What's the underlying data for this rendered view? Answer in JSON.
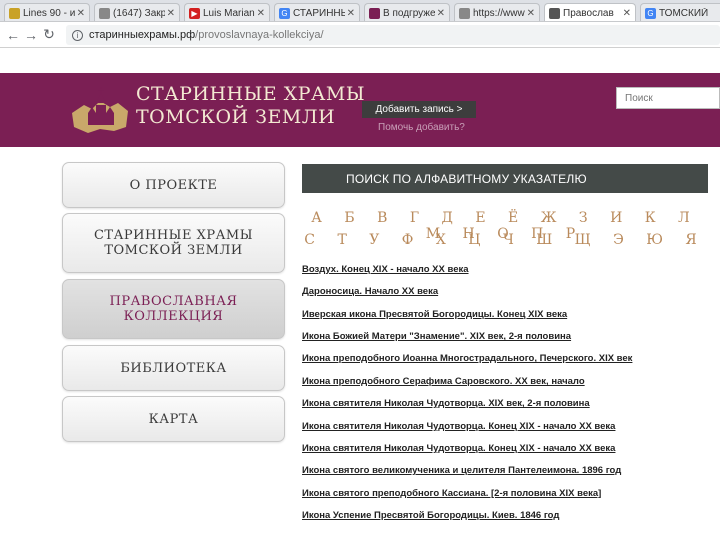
{
  "browser": {
    "tabs": [
      {
        "label": "Lines 90 - и",
        "color": "#c9a227"
      },
      {
        "label": "(1647) Закр",
        "color": "#888888"
      },
      {
        "label": "Luis Mariano",
        "color": "#d32020"
      },
      {
        "label": "СТАРИННЫ",
        "color": "#4285f4"
      },
      {
        "label": "В подгруже",
        "color": "#7b1f54"
      },
      {
        "label": "https://www.",
        "color": "#888888"
      },
      {
        "label": "Православ",
        "color": "#555555"
      },
      {
        "label": "ТОМСКИЙ",
        "color": "#4285f4"
      }
    ],
    "url_host": "старинныехрамы.рф",
    "url_path": "/provoslavnaya-kollekciya/"
  },
  "header": {
    "title_line1": "СТАРИННЫЕ ХРАМЫ",
    "title_line2": "ТОМСКОЙ ЗЕМЛИ",
    "add_button": "Добавить запись >",
    "how_link": "Помочь добавить?",
    "search_placeholder": "Поиск",
    "bg_color": "#7b1f54"
  },
  "sidebar": {
    "items": [
      {
        "label": "О ПРОЕКТЕ",
        "active": false
      },
      {
        "label": "СТАРИННЫЕ ХРАМЫ ТОМСКОЙ ЗЕМЛИ",
        "active": false
      },
      {
        "label": "ПРАВОСЛАВНАЯ КОЛЛЕКЦИЯ",
        "active": true
      },
      {
        "label": "БИБЛИОТЕКА",
        "active": false
      },
      {
        "label": "КАРТА",
        "active": false
      }
    ]
  },
  "content": {
    "heading": "ПОИСК ПО АЛФАВИТНОМУ УКАЗАТЕЛЮ",
    "alphabet_row1": "А Б В Г Д Е Ё Ж З И К Л М Н О П Р",
    "alphabet_row2": "С Т У Ф Х Ц Ч Ш Щ Э Ю Я",
    "items": [
      "Воздух. Конец XIX - начало XX века",
      "Дароносица. Начало XX века",
      "Иверская икона Пресвятой Богородицы. Конец XIX века",
      "Икона Божией Матери \"Знамение\". XIX век, 2-я половина",
      "Икона преподобного Иоанна Многострадального, Печерского. XIX век",
      "Икона преподобного Серафима Саровского. XX век, начало",
      "Икона святителя Николая Чудотворца. XIX век, 2-я половина",
      "Икона святителя Николая Чудотворца. Конец XIX - начало XX века",
      "Икона святителя Николая Чудотворца. Конец XIX - начало XX века",
      "Икона святого великомученика и целителя Пантелеимона. 1896 год",
      "Икона святого преподобного Кассиана. [2-я половина XIX века]",
      "Икона Успение Пресвятой Богородицы. Киев. 1846 год"
    ]
  }
}
